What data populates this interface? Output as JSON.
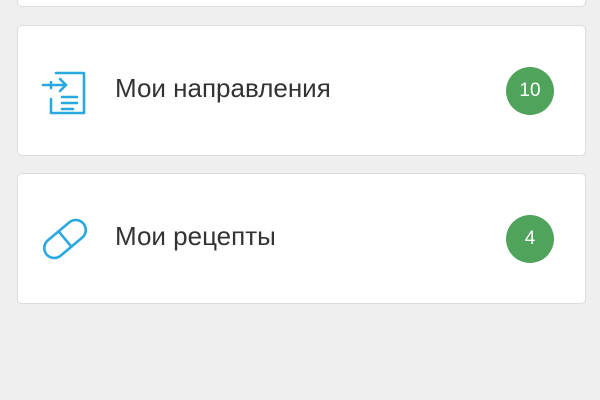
{
  "colors": {
    "background": "#efefef",
    "card_background": "#ffffff",
    "icon_accent": "#2aa8e0",
    "badge_green": "#4fa35a",
    "text": "#333333"
  },
  "menu": {
    "items": [
      {
        "label": "Мои направления",
        "count": "10",
        "icon": "referral-document-icon"
      },
      {
        "label": "Мои рецепты",
        "count": "4",
        "icon": "pill-capsule-icon"
      }
    ]
  }
}
